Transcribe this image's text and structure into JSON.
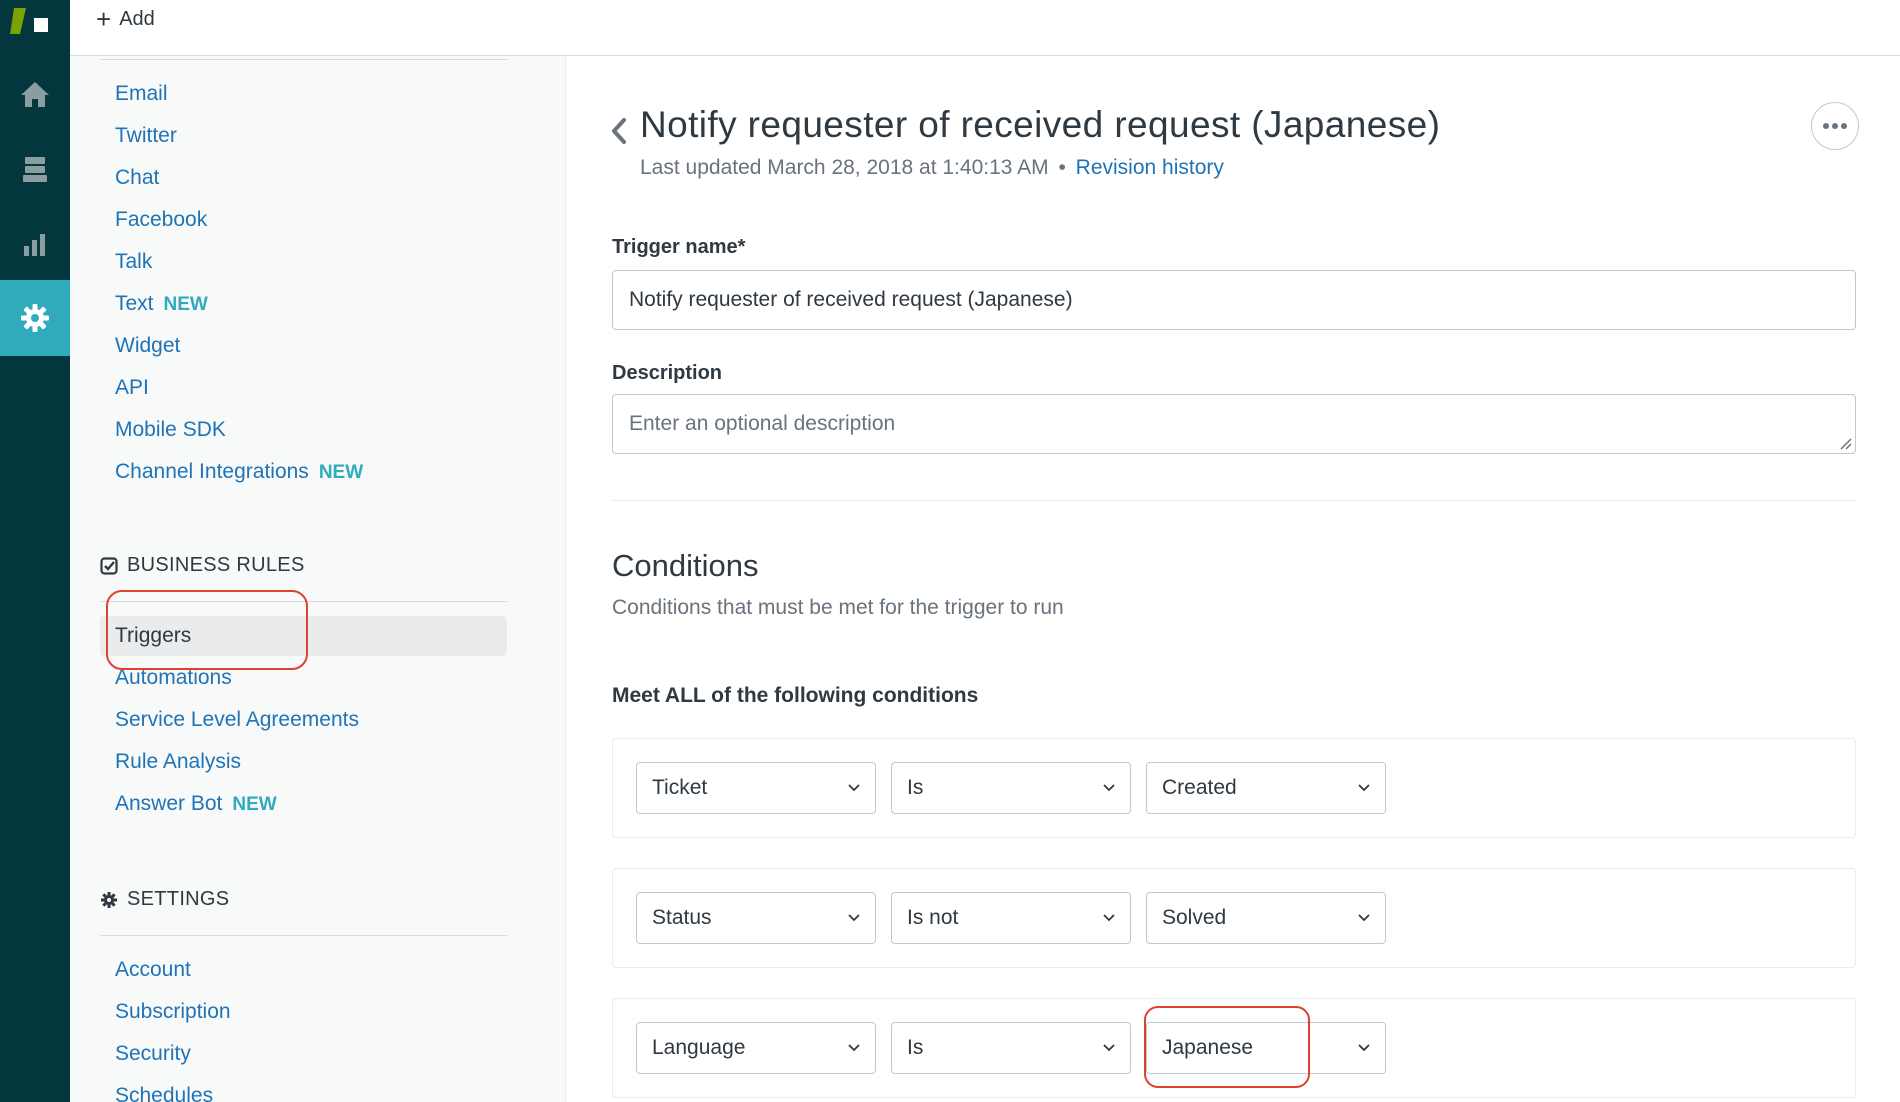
{
  "topbar": {
    "add_label": "Add"
  },
  "rail": {
    "items": [
      {
        "icon": "home-icon"
      },
      {
        "icon": "views-icon"
      },
      {
        "icon": "reporting-icon"
      },
      {
        "icon": "gear-icon",
        "active": true
      }
    ]
  },
  "nav": {
    "channels": [
      {
        "label": "Email"
      },
      {
        "label": "Twitter"
      },
      {
        "label": "Chat"
      },
      {
        "label": "Facebook"
      },
      {
        "label": "Talk"
      },
      {
        "label": "Text",
        "badge": "NEW"
      },
      {
        "label": "Widget"
      },
      {
        "label": "API"
      },
      {
        "label": "Mobile SDK"
      },
      {
        "label": "Channel Integrations",
        "badge": "NEW"
      }
    ],
    "business_rules": {
      "heading": "BUSINESS RULES",
      "items": [
        {
          "label": "Triggers",
          "active": true
        },
        {
          "label": "Automations"
        },
        {
          "label": "Service Level Agreements"
        },
        {
          "label": "Rule Analysis"
        },
        {
          "label": "Answer Bot",
          "badge": "NEW"
        }
      ]
    },
    "settings": {
      "heading": "SETTINGS",
      "items": [
        {
          "label": "Account"
        },
        {
          "label": "Subscription"
        },
        {
          "label": "Security"
        },
        {
          "label": "Schedules"
        }
      ]
    }
  },
  "main": {
    "title": "Notify requester of received request (Japanese)",
    "last_updated": "Last updated March 28, 2018 at 1:40:13 AM",
    "separator": "•",
    "revision_link": "Revision history",
    "trigger_name_label": "Trigger name*",
    "trigger_name_value": "Notify requester of received request (Japanese)",
    "description_label": "Description",
    "description_placeholder": "Enter an optional description",
    "conditions_title": "Conditions",
    "conditions_desc": "Conditions that must be met for the trigger to run",
    "meet_all_label": "Meet ALL of the following conditions",
    "conditions": [
      {
        "field": "Ticket",
        "operator": "Is",
        "value": "Created"
      },
      {
        "field": "Status",
        "operator": "Is not",
        "value": "Solved"
      },
      {
        "field": "Language",
        "operator": "Is",
        "value": "Japanese"
      }
    ]
  },
  "colors": {
    "rail": "#03363d",
    "rail_active": "#30aabc",
    "link": "#1f73b7",
    "badge": "#30aabc",
    "annotation": "#e0412c"
  }
}
